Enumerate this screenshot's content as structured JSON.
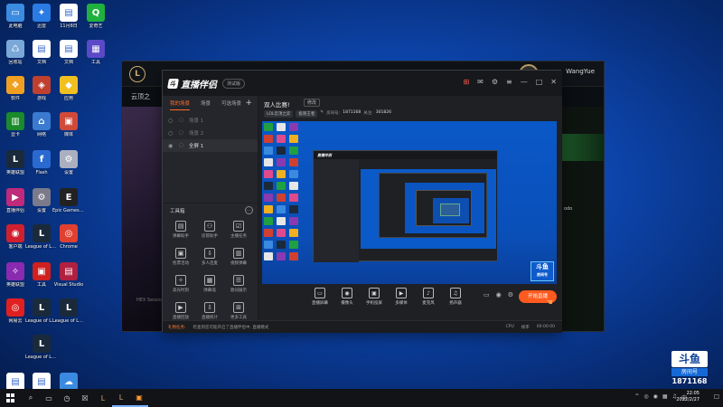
{
  "desktop_icons": [
    {
      "label": "此电脑",
      "color": "#3b8be0",
      "glyph": "▭"
    },
    {
      "label": "迅雷",
      "color": "#2a7be4",
      "glyph": "✦"
    },
    {
      "label": "11月8日",
      "color": "#ffffff",
      "glyph": "▤"
    },
    {
      "label": "爱奇艺",
      "color": "#20b040",
      "glyph": "Q"
    },
    {
      "label": "回收站",
      "color": "#7aa8d8",
      "glyph": "♺"
    },
    {
      "label": "文档",
      "color": "#ffffff",
      "glyph": "▤"
    },
    {
      "label": "文档",
      "color": "#ffffff",
      "glyph": "▤"
    },
    {
      "label": "工具",
      "color": "#5a4ac8",
      "glyph": "▦"
    },
    {
      "label": "软件",
      "color": "#f0a020",
      "glyph": "❖"
    },
    {
      "label": "游戏",
      "color": "#c04030",
      "glyph": "◈"
    },
    {
      "label": "应用",
      "color": "#f0c020",
      "glyph": "◆"
    },
    {
      "label": "",
      "color": "",
      "glyph": ""
    },
    {
      "label": "显卡",
      "color": "#1a8a2a",
      "glyph": "▥"
    },
    {
      "label": "网络",
      "color": "#3a7ad0",
      "glyph": "⌂"
    },
    {
      "label": "媒体",
      "color": "#d04a3a",
      "glyph": "▣"
    },
    {
      "label": "",
      "color": "",
      "glyph": ""
    },
    {
      "label": "英雄联盟",
      "color": "#1a2a3a",
      "glyph": "L"
    },
    {
      "label": "Flash",
      "color": "#2a6ad0",
      "glyph": "f"
    },
    {
      "label": "设置",
      "color": "#aab0c0",
      "glyph": "⚙"
    },
    {
      "label": "",
      "color": "",
      "glyph": ""
    },
    {
      "label": "直播伴侣",
      "color": "#c02a7a",
      "glyph": "▶"
    },
    {
      "label": "设置",
      "color": "#7a7a8a",
      "glyph": "⚙"
    },
    {
      "label": "Epic Games Launcher",
      "color": "#222222",
      "glyph": "E"
    },
    {
      "label": "",
      "color": "",
      "glyph": ""
    },
    {
      "label": "客户端",
      "color": "#d02030",
      "glyph": "◉"
    },
    {
      "label": "League of Legends",
      "color": "#1a2a3a",
      "glyph": "L"
    },
    {
      "label": "Chrome",
      "color": "#e04030",
      "glyph": "◎"
    },
    {
      "label": "",
      "color": "",
      "glyph": ""
    },
    {
      "label": "英雄联盟",
      "color": "#8a2ab0",
      "glyph": "✧"
    },
    {
      "label": "工具",
      "color": "#d02020",
      "glyph": "▣"
    },
    {
      "label": "Visual Studio",
      "color": "#b02040",
      "glyph": "▤"
    },
    {
      "label": "",
      "color": "",
      "glyph": ""
    },
    {
      "label": "网易云",
      "color": "#e02020",
      "glyph": "◎"
    },
    {
      "label": "League of Legends",
      "color": "#1a2a3a",
      "glyph": "L"
    },
    {
      "label": "League of Legends",
      "color": "#1a2a3a",
      "glyph": "L"
    },
    {
      "label": "",
      "color": "",
      "glyph": ""
    },
    {
      "label": "",
      "color": "",
      "glyph": ""
    },
    {
      "label": "League of Legends",
      "color": "#1a2a3a",
      "glyph": "L"
    },
    {
      "label": "",
      "color": "",
      "glyph": ""
    },
    {
      "label": "",
      "color": "",
      "glyph": ""
    },
    {
      "label": "文档",
      "color": "#ffffff",
      "glyph": "▤"
    },
    {
      "label": "文档",
      "color": "#ffffff",
      "glyph": "▤"
    },
    {
      "label": "网盘",
      "color": "#3a8ae0",
      "glyph": "☁"
    }
  ],
  "bg_window": {
    "brand": "",
    "username": "WangYue",
    "coins": "",
    "subtitle": "云顶之",
    "left_text": "HEX Session",
    "right_text": "odo"
  },
  "app": {
    "name": "直播伴侣",
    "logo_glyph": "斗",
    "version_badge": "测试版",
    "tabs": [
      {
        "label": "我的场景",
        "active": true
      },
      {
        "label": "场景",
        "active": false
      },
      {
        "label": "可选场景",
        "active": false
      }
    ],
    "scenes": [
      {
        "label": "场景 1",
        "active": false,
        "visible": false
      },
      {
        "label": "场景 2",
        "active": false,
        "visible": false
      },
      {
        "label": "全屏 1",
        "active": true,
        "visible": true
      }
    ],
    "toolbox_label": "工具箱",
    "tools": [
      {
        "label": "弹幕助手",
        "glyph": "▤"
      },
      {
        "label": "房管助手",
        "glyph": "⚇"
      },
      {
        "label": "主播任务",
        "glyph": "☑"
      },
      {
        "label": "抢票活动",
        "glyph": "▣"
      },
      {
        "label": "多人连麦",
        "glyph": "⇩"
      },
      {
        "label": "视频弹幕",
        "glyph": "▥"
      },
      {
        "label": "高光时刻",
        "glyph": "✧"
      },
      {
        "label": "弹幕墙",
        "glyph": "▦"
      },
      {
        "label": "歌词展示",
        "glyph": "☰"
      },
      {
        "label": "直播回放",
        "glyph": "▶"
      },
      {
        "label": "直播统计",
        "glyph": "⇩"
      },
      {
        "label": "更多工具",
        "glyph": "⊞"
      }
    ],
    "room": {
      "title": "双人比赛!",
      "edit_label": "修改",
      "tag1": "LOL云顶之弈",
      "tag2": "极限王者",
      "stat1_label": "房间号:",
      "stat1_value": "1871168",
      "stat2_label": "关注:",
      "stat2_value": "301826"
    },
    "preview_badge_main": "斗鱼",
    "preview_badge_sub": "房间号",
    "controls": [
      {
        "label": "直播屏幕",
        "glyph": "▭"
      },
      {
        "label": "摄像头",
        "glyph": "◉"
      },
      {
        "label": "手机投屏",
        "glyph": "▣"
      },
      {
        "label": "多媒体",
        "glyph": "▶"
      },
      {
        "label": "麦克风",
        "glyph": "♪"
      },
      {
        "label": "扬声器",
        "glyph": "♫"
      }
    ],
    "live_button": "开始直播",
    "status_left": "礼物任务:",
    "status_msg": "检查到您可能开启了直播伴侣中, 直播模式",
    "status_r1": "CPU",
    "status_r2": "帧率",
    "status_r3": "00:00:00"
  },
  "corner_logo": {
    "main": "斗鱼",
    "sub": "房间号",
    "room_id": "1871168"
  },
  "taskbar": {
    "clock_time": "22:05",
    "clock_date": "2022/2/27",
    "notification_icon": "☐"
  }
}
